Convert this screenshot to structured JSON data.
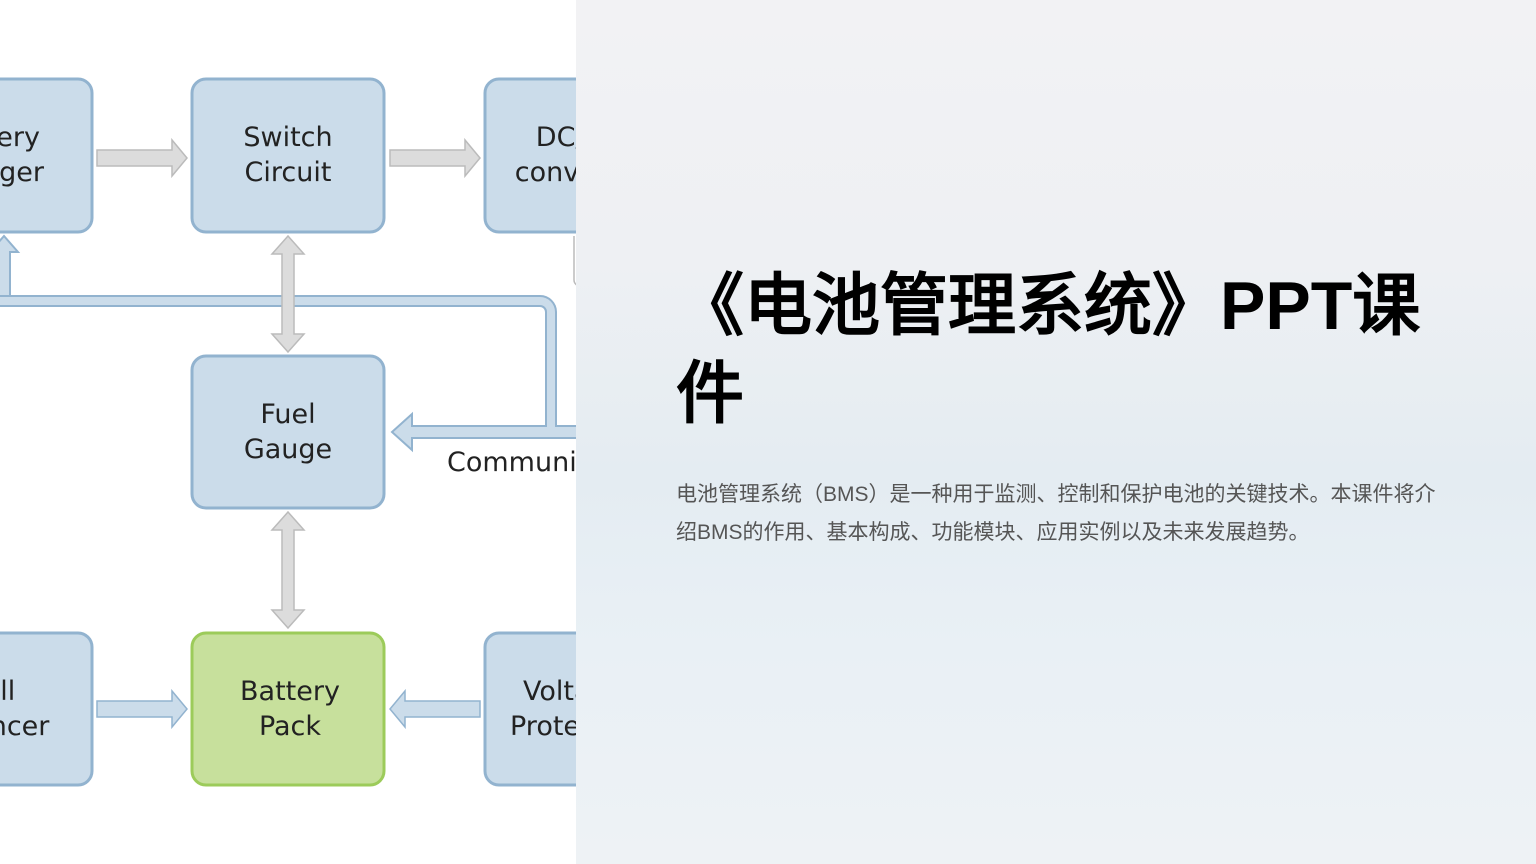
{
  "diagram": {
    "boxes": [
      {
        "id": "charger",
        "lines": [
          "Battery",
          "Charger"
        ]
      },
      {
        "id": "switch",
        "lines": [
          "Switch",
          "Circuit"
        ]
      },
      {
        "id": "dcdc",
        "lines": [
          "DC/DC",
          "converter"
        ]
      },
      {
        "id": "fuel",
        "lines": [
          "Fuel",
          "Gauge"
        ]
      },
      {
        "id": "balancer",
        "lines": [
          "Cell",
          "Balancer"
        ]
      },
      {
        "id": "pack",
        "lines": [
          "Battery",
          "Pack"
        ]
      },
      {
        "id": "protect",
        "lines": [
          "Voltage",
          "Protection"
        ]
      }
    ],
    "bus_label": "Communication",
    "colors": {
      "box_fill": "#cbdcea",
      "box_stroke": "#92b3cf",
      "pack_fill": "#c7e09c",
      "pack_stroke": "#9ccb5a",
      "arrow_gray": "#dcdcdc",
      "arrow_blue": "#cbdcea"
    }
  },
  "slide": {
    "title": "《电池管理系统》PPT课件",
    "description": "电池管理系统（BMS）是一种用于监测、控制和保护电池的关键技术。本课件将介绍BMS的作用、基本构成、功能模块、应用实例以及未来发展趋势。"
  }
}
